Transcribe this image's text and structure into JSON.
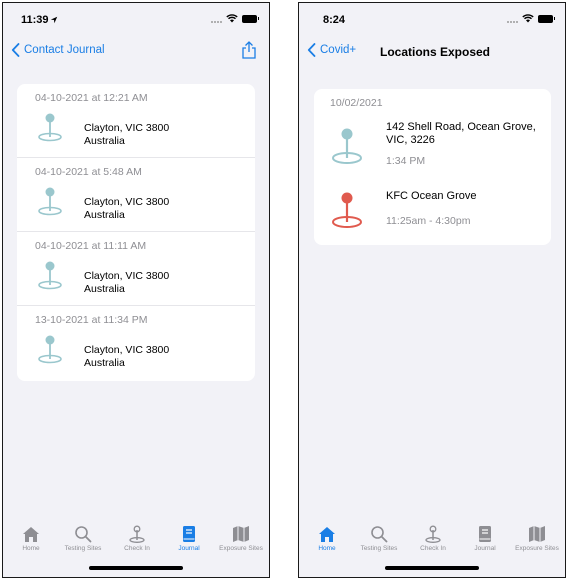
{
  "colors": {
    "accent": "#1a7ee5",
    "pin_teal": "#9ac7cd",
    "pin_red": "#e05a4e",
    "inactive": "#8e8e93"
  },
  "left": {
    "status_time": "11:39",
    "back_label": "Contact Journal",
    "entries": [
      {
        "date": "04-10-2021 at 12:21 AM",
        "line1": "Clayton, VIC 3800",
        "line2": "Australia"
      },
      {
        "date": "04-10-2021 at 5:48 AM",
        "line1": "Clayton, VIC 3800",
        "line2": "Australia"
      },
      {
        "date": "04-10-2021 at 11:11 AM",
        "line1": "Clayton, VIC 3800",
        "line2": "Australia"
      },
      {
        "date": "13-10-2021 at 11:34 PM",
        "line1": "Clayton, VIC 3800",
        "line2": "Australia"
      }
    ],
    "active_tab": "Journal"
  },
  "right": {
    "status_time": "8:24",
    "back_label": "Covid+",
    "title": "Locations Exposed",
    "card_date": "10/02/2021",
    "locations": [
      {
        "name": "142 Shell Road, Ocean Grove, VIC, 3226",
        "time": "1:34 PM",
        "pin": "teal"
      },
      {
        "name": "KFC Ocean Grove",
        "time": "11:25am - 4:30pm",
        "pin": "red"
      }
    ],
    "active_tab": "Home"
  },
  "tabs": [
    {
      "label": "Home",
      "icon": "home-icon"
    },
    {
      "label": "Testing Sites",
      "icon": "search-icon"
    },
    {
      "label": "Check In",
      "icon": "check-in-pin-icon"
    },
    {
      "label": "Journal",
      "icon": "journal-book-icon"
    },
    {
      "label": "Exposure Sites",
      "icon": "map-icon"
    }
  ]
}
